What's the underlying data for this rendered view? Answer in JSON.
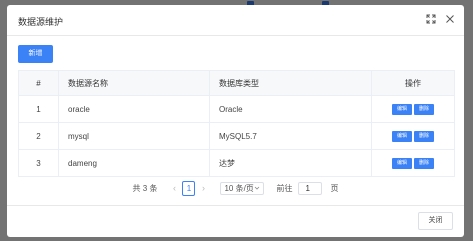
{
  "dialog": {
    "title": "数据源维护",
    "add_label": "新增",
    "close_label": "关闭"
  },
  "table": {
    "headers": [
      "#",
      "数据源名称",
      "数据库类型",
      "操作"
    ],
    "rows": [
      {
        "index": "1",
        "name": "oracle",
        "type": "Oracle",
        "edit": "编辑",
        "delete": "删除"
      },
      {
        "index": "2",
        "name": "mysql",
        "type": "MySQL5.7",
        "edit": "编辑",
        "delete": "删除"
      },
      {
        "index": "3",
        "name": "dameng",
        "type": "达梦",
        "edit": "编辑",
        "delete": "删除"
      }
    ]
  },
  "pagination": {
    "total": "共 3 条",
    "current_page": "1",
    "page_size": "10 条/页",
    "goto_label": "前往",
    "goto_value": "1",
    "page_suffix": "页"
  },
  "icons": [
    "fullscreen-icon",
    "close-icon",
    "chevron-left-icon",
    "chevron-right-icon",
    "chevron-down-icon"
  ],
  "colors": {
    "primary": "#3b82f6",
    "border": "#ebeef5",
    "header_bg": "#f7f8fa"
  }
}
